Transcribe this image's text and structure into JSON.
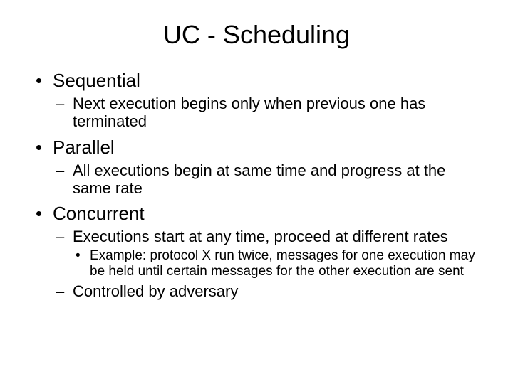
{
  "title": "UC - Scheduling",
  "bullets": {
    "b1": "Sequential",
    "b1_1": "Next execution begins only when previous one has terminated",
    "b2": "Parallel",
    "b2_1": "All executions begin at same time and progress at the same rate",
    "b3": "Concurrent",
    "b3_1": "Executions start at any time, proceed at different rates",
    "b3_1_1": "Example: protocol X run twice, messages for one execution may be held until certain messages for the other execution are sent",
    "b3_2": "Controlled by adversary"
  }
}
